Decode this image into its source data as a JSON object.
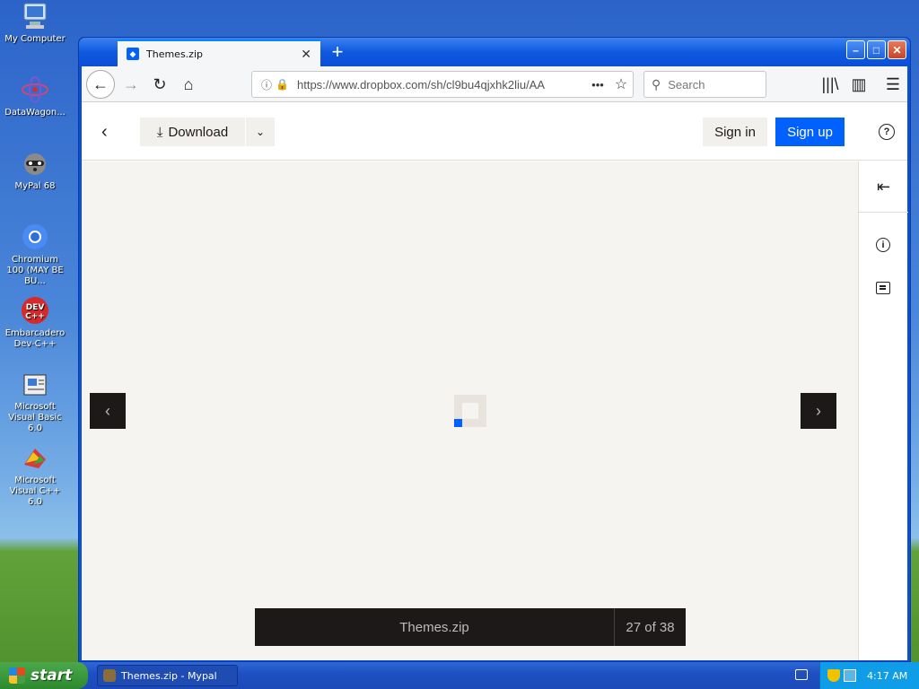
{
  "desktop": {
    "icons": [
      {
        "name": "my-computer",
        "label": "My Computer"
      },
      {
        "name": "datawagon",
        "label": "DataWagon..."
      },
      {
        "name": "mypal",
        "label": "MyPal 68"
      },
      {
        "name": "chromium",
        "label": "Chromium 100 (MAY BE BU..."
      },
      {
        "name": "embarcadero",
        "label": "Embarcadero Dev-C++"
      },
      {
        "name": "vb6",
        "label": "Microsoft Visual Basic 6.0"
      },
      {
        "name": "vcpp6",
        "label": "Microsoft Visual C++ 6.0"
      }
    ]
  },
  "browser": {
    "tab_title": "Themes.zip",
    "tab_close_icon": "close-icon",
    "new_tab": "+",
    "url": "https://www.dropbox.com/sh/cl9bu4qjxhk2liu/AA",
    "url_host": "dropbox.com",
    "search_placeholder": "Search"
  },
  "dropbox": {
    "download_label": "Download",
    "signin_label": "Sign in",
    "signup_label": "Sign up",
    "help_label": "?",
    "file_name": "Themes.zip",
    "file_position": "27 of 38",
    "accent_color": "#0061fe"
  },
  "taskbar": {
    "start_label": "start",
    "task_title": "Themes.zip - Mypal",
    "clock": "4:17 AM"
  }
}
